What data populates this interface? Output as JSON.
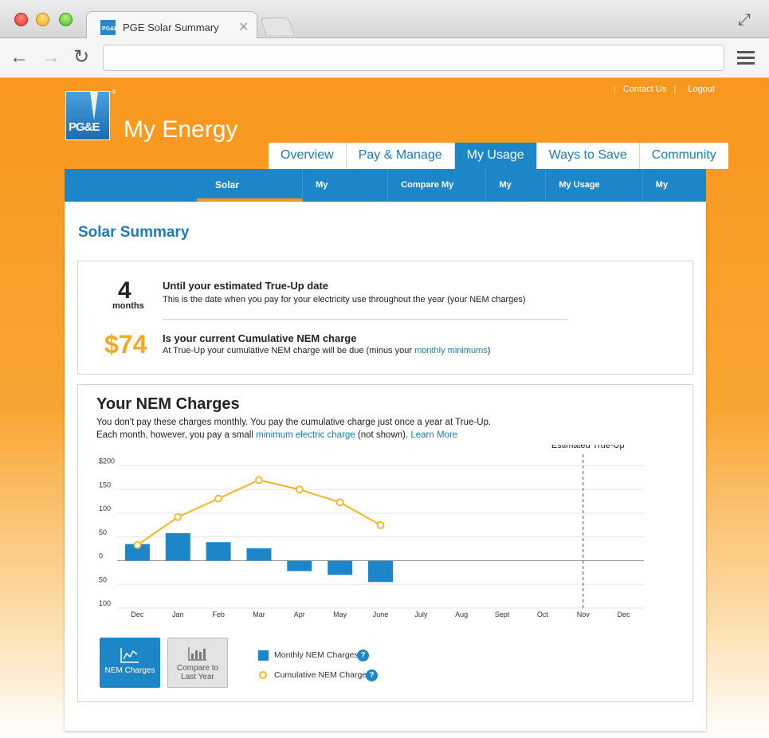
{
  "browser": {
    "tab_title": "PGE Solar Summary",
    "tab_close": "✕",
    "favicon_text": "PG&E"
  },
  "header": {
    "contact_us": "Contact Us",
    "logout": "Logout",
    "separator": "|",
    "logo_text": "PG&E",
    "registered": "®",
    "title": "My Energy"
  },
  "main_tabs": [
    {
      "label": "Overview",
      "active": false
    },
    {
      "label": "Pay & Manage",
      "active": false
    },
    {
      "label": "My Usage",
      "active": true
    },
    {
      "label": "Ways to Save",
      "active": false
    },
    {
      "label": "Community",
      "active": false
    }
  ],
  "sub_nav": [
    {
      "label": "Solar Summary",
      "active": true
    },
    {
      "label": "My Dashboard",
      "active": false
    },
    {
      "label": "Compare My Bills",
      "active": false
    },
    {
      "label": "My Goal",
      "active": false
    },
    {
      "label": "My Usage Details",
      "active": false
    },
    {
      "label": "My Rates",
      "active": false
    }
  ],
  "page_title": "Solar Summary",
  "summary": {
    "months_value": "4",
    "months_unit": "months",
    "trueup_title": "Until your estimated True-Up date",
    "trueup_desc": "This is the date when you pay for your electricity use throughout the year (your NEM charges)",
    "charge_value": "$74",
    "charge_title": "Is your current Cumulative NEM charge",
    "charge_desc_prefix": "At True-Up your cumulative NEM charge will be due (minus your ",
    "charge_desc_link": "monthly minimums",
    "charge_desc_suffix": ")"
  },
  "nem": {
    "title": "Your NEM Charges",
    "line1": "You don't pay these charges monthly. You pay the cumulative charge just once a year at True-Up.",
    "line2_prefix": "Each month, however, you pay a small ",
    "line2_link1": "minimum electric charge",
    "line2_middle": " (not shown). ",
    "line2_link2": "Learn More",
    "btn_nem": "NEM Charges",
    "btn_compare_1": "Compare to",
    "btn_compare_2": "Last Year",
    "legend_monthly": "Monthly NEM Charges",
    "legend_cumulative": "Cumulative NEM Charges",
    "help_glyph": "?"
  },
  "chart_data": {
    "type": "bar",
    "categories": [
      "Dec",
      "Jan",
      "Feb",
      "Mar",
      "Apr",
      "May",
      "June",
      "July",
      "Aug",
      "Sept",
      "Oct",
      "Nov",
      "Dec"
    ],
    "y_tick_labels": [
      "$200",
      "150",
      "100",
      "50",
      "0",
      "50",
      "100"
    ],
    "y_tick_values": [
      200,
      150,
      100,
      50,
      0,
      -50,
      -100
    ],
    "ylim": [
      -100,
      200
    ],
    "series": [
      {
        "name": "Monthly NEM Charges",
        "type": "bar",
        "color": "#1d86c8",
        "values": [
          35,
          58,
          39,
          26,
          -22,
          -30,
          -45,
          null,
          null,
          null,
          null,
          null,
          null
        ]
      },
      {
        "name": "Cumulative NEM Charges",
        "type": "line",
        "color": "#f4b628",
        "values": [
          33,
          92,
          131,
          170,
          150,
          123,
          75,
          null,
          null,
          null,
          null,
          null,
          null
        ]
      }
    ],
    "annotation": {
      "label": "Estimated True-Up",
      "category_index": 11
    },
    "grid": true
  }
}
